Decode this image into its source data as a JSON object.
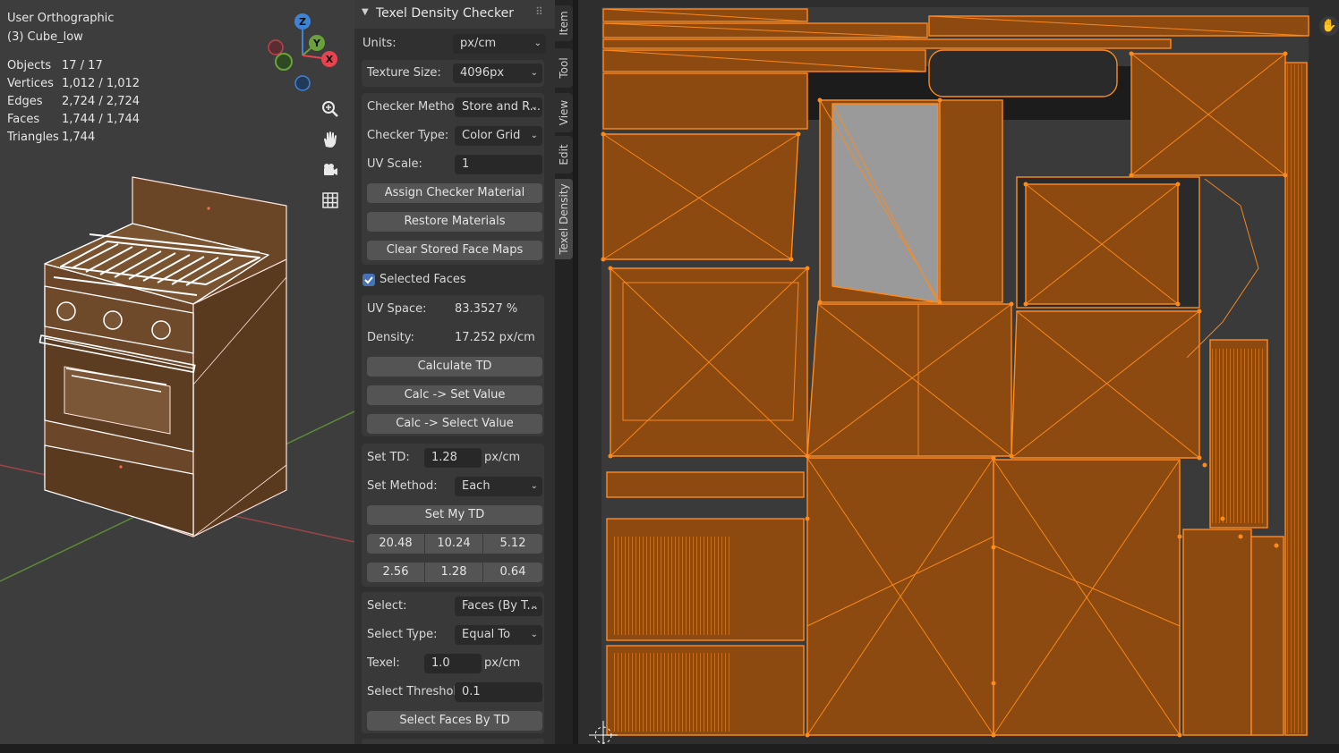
{
  "viewport": {
    "view_name": "User Orthographic",
    "object_name": "(3) Cube_low",
    "stats": [
      {
        "label": "Objects",
        "value": "17 / 17"
      },
      {
        "label": "Vertices",
        "value": "1,012 / 1,012"
      },
      {
        "label": "Edges",
        "value": "2,724 / 2,724"
      },
      {
        "label": "Faces",
        "value": "1,744 / 1,744"
      },
      {
        "label": "Triangles",
        "value": "1,744"
      }
    ],
    "gizmo": {
      "z": "Z",
      "y": "Y",
      "x": "X"
    },
    "colors": {
      "x_axis": "#e8434f",
      "y_axis": "#6aa13b",
      "z_axis": "#3f83d6",
      "selection": "#ff8f80"
    }
  },
  "panel": {
    "title": "Texel Density Checker",
    "units_label": "Units:",
    "units_value": "px/cm",
    "texture_size_label": "Texture Size:",
    "texture_size_value": "4096px",
    "checker_method_label": "Checker Method:",
    "checker_method_value": "Store and R...",
    "checker_type_label": "Checker Type:",
    "checker_type_value": "Color Grid",
    "uv_scale_label": "UV Scale:",
    "uv_scale_value": "1",
    "assign_checker_label": "Assign Checker Material",
    "restore_materials_label": "Restore Materials",
    "clear_face_maps_label": "Clear Stored Face Maps",
    "selected_faces_label": "Selected Faces",
    "selected_faces_checked": true,
    "uv_space_label": "UV Space:",
    "uv_space_value": "83.3527 %",
    "density_label": "Density:",
    "density_value": "17.252 px/cm",
    "calculate_td_label": "Calculate TD",
    "calc_set_value_label": "Calc -> Set Value",
    "calc_select_value_label": "Calc -> Select Value",
    "set_td_label": "Set TD:",
    "set_td_value": "1.28",
    "set_td_unit": "px/cm",
    "set_method_label": "Set Method:",
    "set_method_value": "Each",
    "set_my_td_label": "Set My TD",
    "presets_row1": [
      "20.48",
      "10.24",
      "5.12"
    ],
    "presets_row2": [
      "2.56",
      "1.28",
      "0.64"
    ],
    "select_label": "Select:",
    "select_value": "Faces (By T...",
    "select_type_label": "Select Type:",
    "select_type_value": "Equal To",
    "texel_label": "Texel:",
    "texel_value": "1.0",
    "texel_unit": "px/cm",
    "select_threshold_label": "Select Threshold:",
    "select_threshold_value": "0.1",
    "select_faces_label": "Select Faces By TD"
  },
  "tabs": [
    {
      "label": "Item",
      "active": false
    },
    {
      "label": "Tool",
      "active": false
    },
    {
      "label": "View",
      "active": false
    },
    {
      "label": "Edit",
      "active": false
    },
    {
      "label": "Texel Density",
      "active": true
    }
  ],
  "uv": {
    "colors": {
      "island_fill": "#8c4a10",
      "edge": "#ff8a1c"
    }
  }
}
